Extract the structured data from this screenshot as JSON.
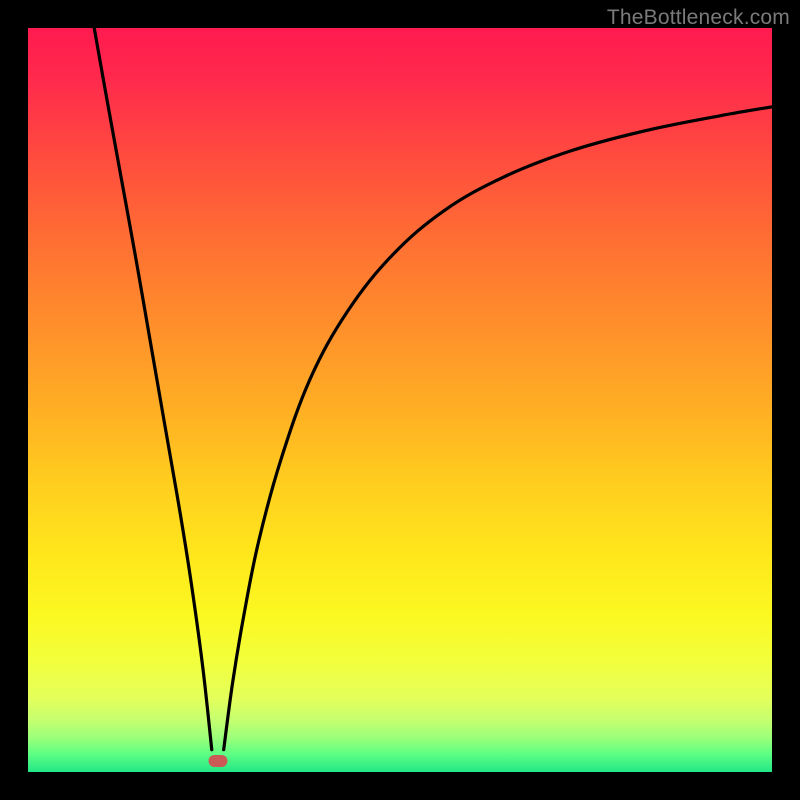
{
  "watermark": "TheBottleneck.com",
  "chart_data": {
    "type": "line",
    "title": "",
    "xlabel": "",
    "ylabel": "",
    "xlim": [
      0,
      100
    ],
    "ylim": [
      0,
      100
    ],
    "grid": false,
    "legend": false,
    "series": [
      {
        "name": "left-branch",
        "x": [
          8.9,
          10.5,
          12.5,
          14.5,
          16.5,
          18.5,
          20.5,
          22.0,
          23.5,
          24.7
        ],
        "values": [
          100,
          91,
          80,
          69,
          57.5,
          46,
          34.5,
          25,
          14,
          3
        ]
      },
      {
        "name": "right-branch",
        "x": [
          26.3,
          27.5,
          29,
          31,
          34,
          38,
          43,
          49,
          56,
          64,
          73,
          83,
          93,
          100
        ],
        "values": [
          3,
          12,
          21,
          31,
          42,
          53,
          62,
          69.5,
          75.5,
          80,
          83.5,
          86.2,
          88.2,
          89.4
        ]
      }
    ],
    "marker": {
      "x": 25.5,
      "y": 1.5,
      "color": "#cb5a56"
    },
    "background_gradient": {
      "top": "#ff1a4f",
      "middle": "#ffd01e",
      "bottom": "#22e787"
    }
  }
}
